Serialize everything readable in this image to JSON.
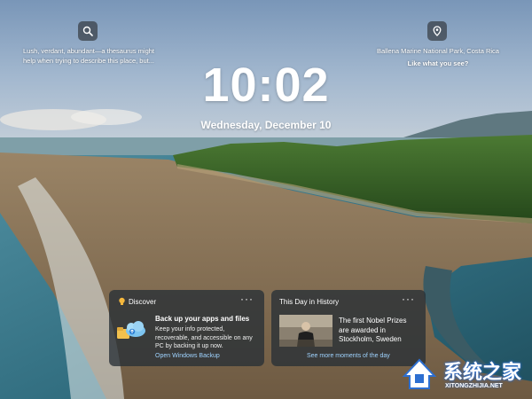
{
  "lock_screen": {
    "time": "10:02",
    "date": "Wednesday, December 10"
  },
  "left_tip": {
    "icon": "search-icon",
    "text": "Lush, verdant, abundant—a thesaurus might help when trying to describe this place, but..."
  },
  "right_tip": {
    "icon": "location-pin-icon",
    "location": "Ballena Marine National Park, Costa Rica",
    "prompt": "Like what you see?"
  },
  "discover_card": {
    "title": "Discover",
    "more": "···",
    "heading": "Back up your apps and files",
    "body": "Keep your info protected, recoverable, and accessible on any PC by backing it up now.",
    "link": "Open Windows Backup"
  },
  "history_card": {
    "title": "This Day in History",
    "more": "···",
    "heading": "The first Nobel Prizes are awarded in Stockholm, Sweden",
    "link": "See more moments of the day"
  },
  "watermark": {
    "logo_text": "系统之家",
    "url": "XITONGZHIJIA.NET"
  },
  "colors": {
    "card_bg": "#283036",
    "link": "#9fd3ff",
    "sky": "#8ea9c7",
    "sea": "#2f6b7d",
    "sand": "#8a7456",
    "forest": "#2f5a1f",
    "watermark_blue": "#2d6fd1"
  }
}
